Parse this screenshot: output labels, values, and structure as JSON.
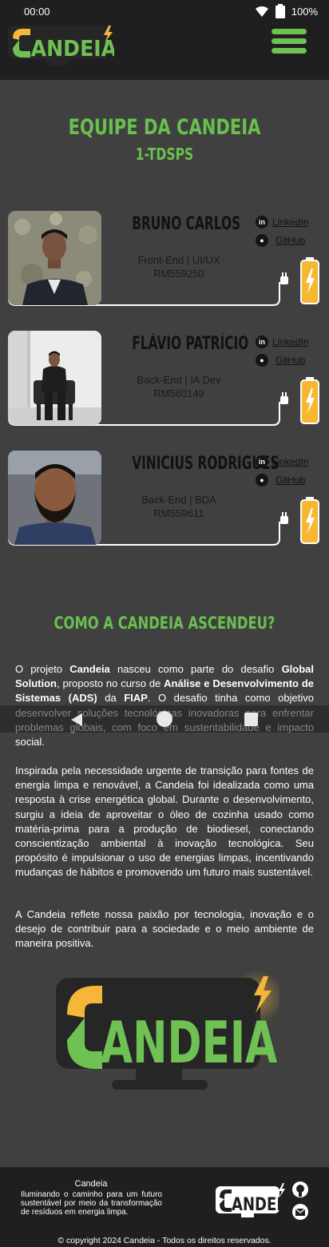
{
  "status_bar": {
    "time": "00:00",
    "battery": "100%"
  },
  "header": {
    "logo_alt": "Candeia"
  },
  "team": {
    "title": "EQUIPE DA CANDEIA",
    "subtitle": "1-TDSPS"
  },
  "members": [
    {
      "name": "BRUNO CARLOS",
      "role": "Front-End | UI/UX",
      "rm": "RM559250",
      "linkedin": "LinkedIn",
      "github": "GitHub"
    },
    {
      "name": "FLÁVIO PATRÍCIO",
      "role": "Back-End | IA Dev",
      "rm": "RM560149",
      "linkedin": "LinkedIn",
      "github": "GitHub"
    },
    {
      "name": "VINICIUS RODRIGUES",
      "role": "Back-End | BDA",
      "rm": "RM559611",
      "linkedin": "LinkedIn",
      "github": "GitHub"
    }
  ],
  "about": {
    "title": "COMO A CANDEIA ASCENDEU?",
    "p1_parts": [
      "O projeto ",
      "Candeia",
      " nasceu como parte do desafio ",
      "Global Solution",
      ", proposto no curso de ",
      "Análise e Desenvolvimento de Sistemas (ADS)",
      " da ",
      "FIAP",
      ". O desafio tinha como objetivo desenvolver soluções tecnológicas inovadoras para enfrentar problemas globais, com foco em sustentabilidade e impacto social."
    ],
    "p2": "Inspirada pela necessidade urgente de transição para fontes de energia limpa e renovável, a Candeia foi idealizada como uma resposta à crise energética global. Durante o desenvolvimento, surgiu a ideia de aproveitar o óleo de cozinha usado como matéria-prima para a produção de biodiesel, conectando conscientização ambiental à inovação tecnológica. Seu propósito é impulsionar o uso de energias limpas, incentivando mudanças de hábitos e promovendo um futuro mais sustentável.",
    "p3": "A Candeia reflete nossa paixão por tecnologia, inovação e o desejo de contribuir para a sociedade e o meio ambiente de maneira positiva."
  },
  "footer": {
    "name": "Candeia",
    "description": "Iluminando o caminho para um futuro sustentável por meio da transformação de resíduos em energia limpa.",
    "copyright": "© copyright 2024 Candeia - Todos os direitos reservados."
  },
  "colors": {
    "accent_green": "#69c04e",
    "battery_yellow": "#f7b731",
    "background": "#404040",
    "bar": "#1f1f1f"
  }
}
